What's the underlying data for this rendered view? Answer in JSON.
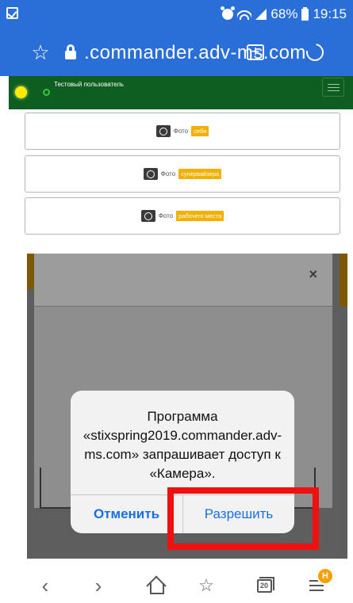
{
  "status_bar": {
    "battery": "68%",
    "time": "19:15"
  },
  "address_bar": {
    "url": ".commander.adv-ms.com"
  },
  "site_header": {
    "user_name": "Тестовый пользователь"
  },
  "photo_buttons": [
    {
      "word": "Фото",
      "tag": "себя"
    },
    {
      "word": "Фото",
      "tag": "супервайзера"
    },
    {
      "word": "Фото",
      "tag": "рабочего места"
    }
  ],
  "modal": {
    "close_label": "×"
  },
  "permission_dialog": {
    "message": "Программа «stixspring2019.commander.adv-ms.com» запрашивает доступ к «Камера».",
    "cancel_label": "Отменить",
    "allow_label": "Разрешить"
  },
  "bottom_nav": {
    "tabs_count": "20",
    "menu_badge": "Н"
  },
  "colors": {
    "browser_blue": "#2a6ed8",
    "site_header_green": "#0d5e20",
    "tag_yellow": "#f2b100",
    "ios_link_blue": "#1a6fe0",
    "highlight_red": "#f01010",
    "badge_orange": "#f5a100"
  }
}
